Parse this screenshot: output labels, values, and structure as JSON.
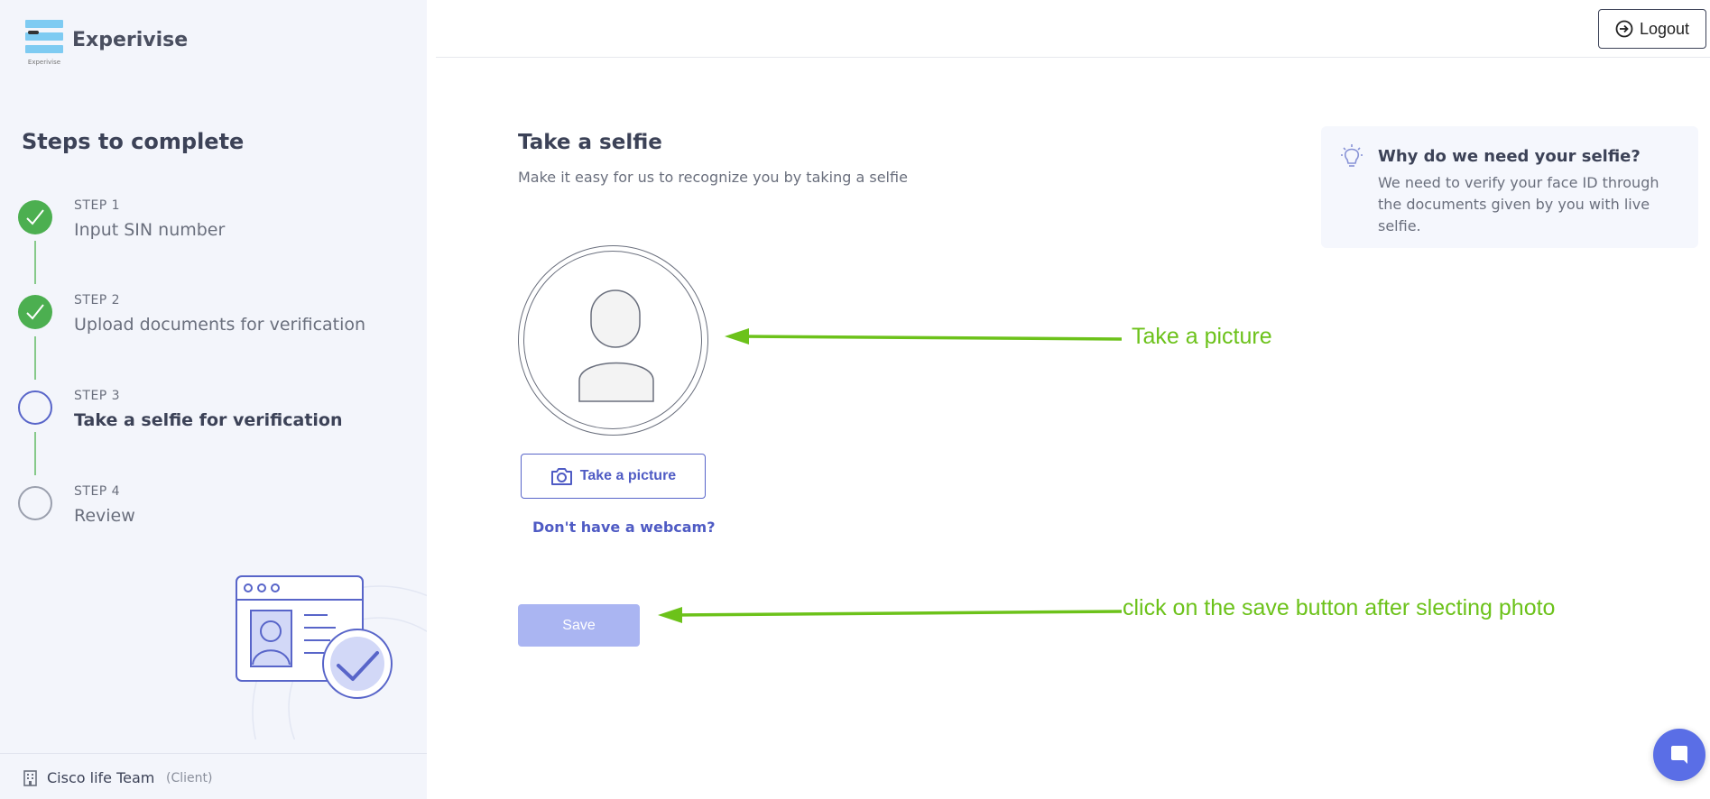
{
  "brand": {
    "name": "Experivise",
    "logo_caption": "Experivise"
  },
  "sidebar": {
    "title": "Steps to complete",
    "steps": [
      {
        "label": "STEP 1",
        "name": "Input SIN number",
        "status": "completed"
      },
      {
        "label": "STEP 2",
        "name": "Upload documents for verification",
        "status": "completed"
      },
      {
        "label": "STEP 3",
        "name": "Take a selfie for verification",
        "status": "current"
      },
      {
        "label": "STEP 4",
        "name": "Review",
        "status": "pending"
      }
    ],
    "footer": {
      "team": "Cisco life Team",
      "role": "(Client)"
    }
  },
  "header": {
    "logout_label": "Logout"
  },
  "main": {
    "title": "Take a selfie",
    "subtitle": "Make it easy for us to recognize you by taking a selfie",
    "take_picture_label": "Take a picture",
    "webcam_link": "Don't have a webcam?",
    "save_label": "Save"
  },
  "info": {
    "title": "Why do we need your selfie?",
    "body": "We need to verify your face ID through the documents given by you with live selfie."
  },
  "annotations": {
    "take_picture": "Take a picture",
    "save": "click on the save button after slecting photo"
  },
  "colors": {
    "sidebar_bg": "#f3f5fb",
    "accent": "#5865c9",
    "completed": "#4caf50",
    "save_disabled": "#aab5f2",
    "annotation": "#6cc21a",
    "chat": "#5a6ee6"
  },
  "icons": {
    "logout": "logout-icon",
    "camera": "camera-icon",
    "bulb": "lightbulb-icon",
    "building": "building-icon",
    "chat": "chat-icon",
    "check": "check-icon"
  }
}
